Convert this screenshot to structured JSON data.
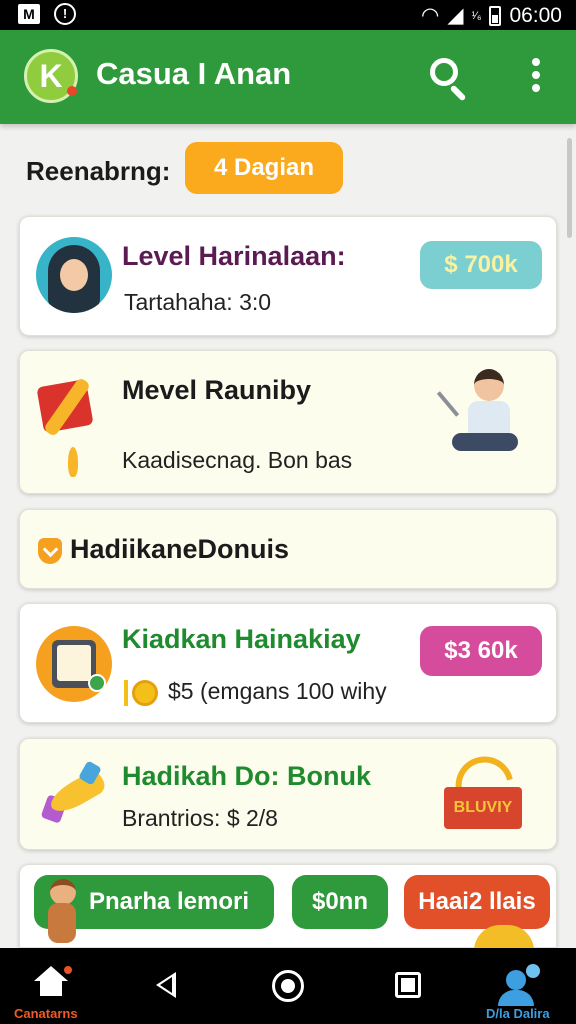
{
  "status_bar": {
    "signal_small": "¹⁄₆",
    "time": "06:00"
  },
  "app_bar": {
    "title": "Casua I Anan",
    "logo_letter": "K",
    "icons": [
      "search-icon",
      "more-vert-icon"
    ],
    "color": "#2f9a3b"
  },
  "filter": {
    "label": "Reenabrng:",
    "button_label": "4 Dagian",
    "button_color": "#fbaa1d"
  },
  "cards": [
    {
      "title": "Level Harinalaan:",
      "subtitle": "Tartahaha: 3:0",
      "pill": "$ 700k",
      "pill_color": "#7ccfd0",
      "icon": "avatar-woman-hijab"
    },
    {
      "title": "Mevel Rauniby",
      "subtitle": "Kaadisecnag. Bon bas",
      "icon": "gift-box-icon"
    },
    {
      "title": "HadiikaneDonuis",
      "icon": "badge-check-icon"
    },
    {
      "title": "Kiadkan Hainakiay",
      "subtitle": "$5 (emgans 100 wihy",
      "pill": "$3 60k",
      "pill_color": "#d64c9c",
      "icon": "tablet-coin-icon"
    },
    {
      "title": "Hadikah Do: Bonuk",
      "subtitle": "Brantrios: $ 2/8",
      "icon": "rocket-icon",
      "box_label": "BLUVIY"
    }
  ],
  "bottom_card": {
    "buttons": [
      "Pnarha lemori",
      "$0nn",
      "Haai2 llais"
    ]
  },
  "nav_bar": {
    "home_label": "Canatarns",
    "profile_label": "D/la Dalira"
  }
}
